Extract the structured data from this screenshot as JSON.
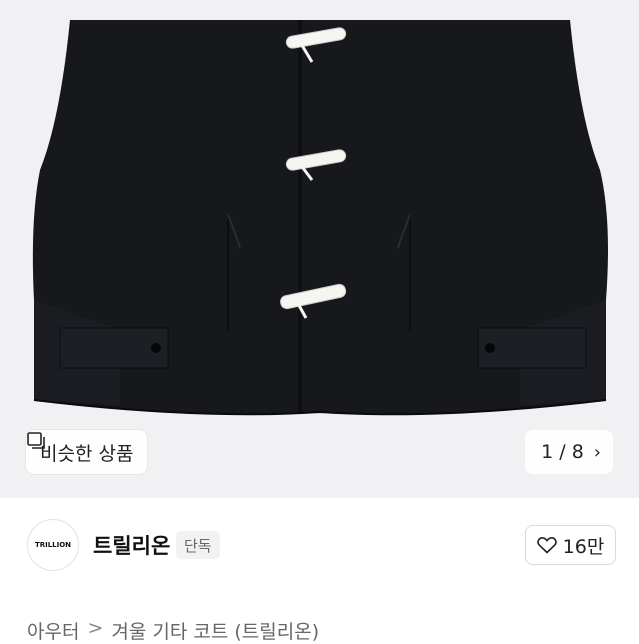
{
  "product_image": {
    "alt": "black duffle coat with white toggles"
  },
  "overlay": {
    "similar_label": "비슷한 상품",
    "similar_icon": "similar-items-icon",
    "page_counter": "1 / 8",
    "next_icon": "chevron-right-icon"
  },
  "seller": {
    "logo_text": "TRILLION",
    "name": "트릴리온",
    "badge": "단독"
  },
  "like": {
    "icon": "heart-icon",
    "count": "16만"
  },
  "breadcrumb": {
    "items": [
      "아우터",
      "겨울 기타 코트 (트릴리온)"
    ],
    "separator": ">"
  }
}
